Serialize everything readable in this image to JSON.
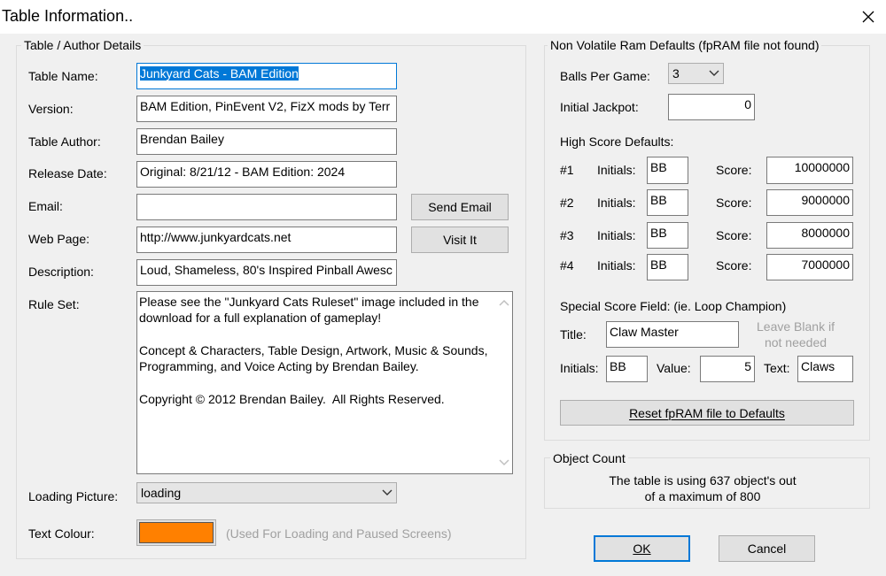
{
  "window": {
    "title": "Table Information.."
  },
  "colors": {
    "text_colour_swatch": "#ff8000",
    "selection": "#0078d7"
  },
  "author_group": {
    "label": "Table / Author Details",
    "table_name": {
      "label": "Table Name:",
      "value": "Junkyard Cats - BAM Edition"
    },
    "version": {
      "label": "Version:",
      "value": "BAM Edition, PinEvent V2, FizX mods by Terr"
    },
    "author": {
      "label": "Table Author:",
      "value": "Brendan Bailey"
    },
    "release_date": {
      "label": "Release Date:",
      "value": "Original: 8/21/12 - BAM Edition: 2024"
    },
    "email": {
      "label": "Email:",
      "value": "",
      "button": "Send Email"
    },
    "web_page": {
      "label": "Web Page:",
      "value": "http://www.junkyardcats.net",
      "button": "Visit It"
    },
    "description": {
      "label": "Description:",
      "value": "Loud, Shameless, 80's Inspired Pinball Awesc"
    },
    "rule_set": {
      "label": "Rule Set:",
      "value": "Please see the \"Junkyard Cats Ruleset\" image included in the download for a full explanation of gameplay!\n\nConcept & Characters, Table Design, Artwork, Music & Sounds, Programming, and Voice Acting by Brendan Bailey.\n\nCopyright © 2012 Brendan Bailey.  All Rights Reserved."
    },
    "loading_picture": {
      "label": "Loading Picture:",
      "value": "loading"
    },
    "text_colour": {
      "label": "Text Colour:",
      "hint": "(Used For Loading and Paused Screens)"
    }
  },
  "nvram_group": {
    "label": "Non Volatile Ram Defaults (fpRAM file not found)",
    "balls_per_game": {
      "label": "Balls Per Game:",
      "value": "3"
    },
    "initial_jackpot": {
      "label": "Initial Jackpot:",
      "value": "0"
    },
    "high_score_label": "High Score Defaults:",
    "initials_label": "Initials:",
    "score_label": "Score:",
    "high_scores": [
      {
        "rank": "#1",
        "initials": "BB",
        "score": "10000000"
      },
      {
        "rank": "#2",
        "initials": "BB",
        "score": "9000000"
      },
      {
        "rank": "#3",
        "initials": "BB",
        "score": "8000000"
      },
      {
        "rank": "#4",
        "initials": "BB",
        "score": "7000000"
      }
    ],
    "special": {
      "label": "Special Score Field: (ie. Loop Champion)",
      "title_label": "Title:",
      "title": "Claw Master",
      "leave_blank_1": "Leave Blank if",
      "leave_blank_2": "not needed",
      "initials_label": "Initials:",
      "initials": "BB",
      "value_label": "Value:",
      "value": "5",
      "text_label": "Text:",
      "text": "Claws"
    },
    "reset_button": "Reset fpRAM file to Defaults"
  },
  "object_count": {
    "label": "Object Count",
    "line1": "The table is using 637 object's out",
    "line2": "of a maximum of 800"
  },
  "buttons": {
    "ok": "OK",
    "cancel": "Cancel"
  }
}
